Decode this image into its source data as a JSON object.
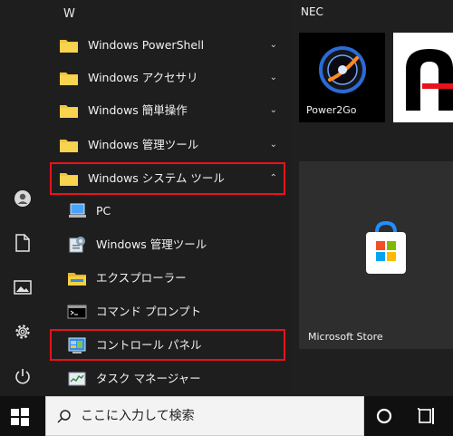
{
  "start_menu": {
    "section_letter": "W",
    "apps": [
      {
        "label": "Windows PowerShell",
        "icon": "folder-icon",
        "chevron": "⌄"
      },
      {
        "label": "Windows アクセサリ",
        "icon": "folder-icon",
        "chevron": "⌄"
      },
      {
        "label": "Windows 簡単操作",
        "icon": "folder-icon",
        "chevron": "⌄"
      },
      {
        "label": "Windows 管理ツール",
        "icon": "folder-icon",
        "chevron": "⌄"
      },
      {
        "label": "Windows システム ツール",
        "icon": "folder-icon",
        "chevron": "⌃"
      }
    ],
    "subitems": [
      {
        "label": "PC",
        "icon": "pc-icon"
      },
      {
        "label": "Windows 管理ツール",
        "icon": "admin-tools-icon"
      },
      {
        "label": "エクスプローラー",
        "icon": "file-explorer-icon"
      },
      {
        "label": "コマンド プロンプト",
        "icon": "command-prompt-icon"
      },
      {
        "label": "コントロール パネル",
        "icon": "control-panel-icon"
      },
      {
        "label": "タスク マネージャー",
        "icon": "task-manager-icon"
      }
    ]
  },
  "tiles": {
    "group_label": "NEC",
    "power2go": "Power2Go",
    "store": "Microsoft Store"
  },
  "taskbar": {
    "search_placeholder": "ここに入力して検索"
  },
  "colors": {
    "highlight": "#e8121b",
    "background": "#1f1f1f",
    "accent_blue": "#1e90ff"
  }
}
